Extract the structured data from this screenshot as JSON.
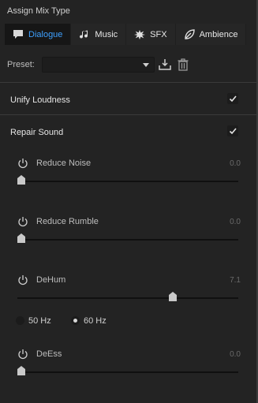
{
  "section": {
    "title": "Assign Mix Type"
  },
  "mix_types": [
    {
      "label": "Dialogue",
      "icon": "speech-bubble-icon",
      "active": true
    },
    {
      "label": "Music",
      "icon": "music-note-icon",
      "active": false
    },
    {
      "label": "SFX",
      "icon": "burst-icon",
      "active": false
    },
    {
      "label": "Ambience",
      "icon": "leaf-icon",
      "active": false
    }
  ],
  "preset": {
    "label": "Preset:",
    "value": ""
  },
  "unify_loudness": {
    "label": "Unify Loudness",
    "checked": true
  },
  "repair_sound": {
    "label": "Repair Sound",
    "checked": true
  },
  "controls": {
    "reduce_noise": {
      "label": "Reduce Noise",
      "value": "0.0",
      "level": 0.0
    },
    "reduce_rumble": {
      "label": "Reduce Rumble",
      "value": "0.0",
      "level": 0.0
    },
    "dehum": {
      "label": "DeHum",
      "value": "7.1",
      "level": 0.71
    },
    "deess": {
      "label": "DeEss",
      "value": "0.0",
      "level": 0.0
    }
  },
  "dehum_freq": {
    "options": [
      "50 Hz",
      "60 Hz"
    ],
    "selected": "60 Hz"
  },
  "colors": {
    "accent": "#3ea0ff",
    "background": "#232323"
  }
}
